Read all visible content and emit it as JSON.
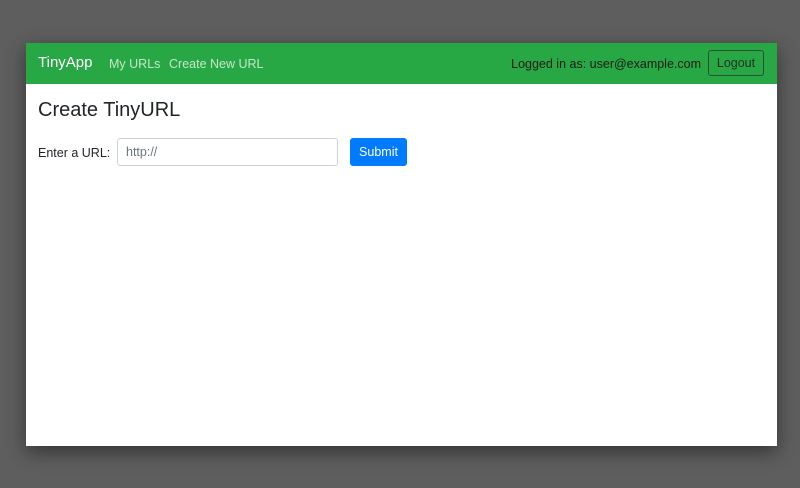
{
  "colors": {
    "navbar_bg": "#28a745",
    "primary": "#007bff",
    "backdrop": "#5e5e5e",
    "content_bg": "#ffffff"
  },
  "navbar": {
    "brand": "TinyApp",
    "links": [
      {
        "label": "My URLs"
      },
      {
        "label": "Create New URL"
      }
    ],
    "login_status": "Logged in as: user@example.com",
    "logout_label": "Logout"
  },
  "main": {
    "title": "Create TinyURL",
    "form": {
      "url_label": "Enter a URL:",
      "url_value": "",
      "url_placeholder": "http://",
      "submit_label": "Submit"
    }
  }
}
